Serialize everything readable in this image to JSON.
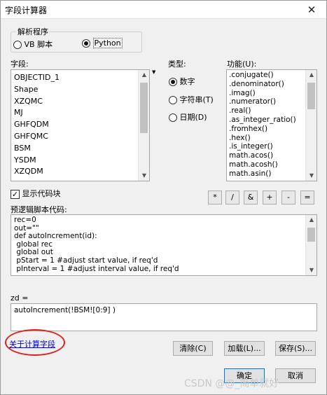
{
  "window": {
    "title": "字段计算器",
    "close_glyph": "✕"
  },
  "parser": {
    "label": "解析程序",
    "options": [
      {
        "label": "VB 脚本",
        "selected": false
      },
      {
        "label": "Python",
        "selected": true
      }
    ]
  },
  "fields": {
    "label": "字段:",
    "items": [
      "OBJECTID_1",
      "Shape",
      "XZQMC",
      "MJ",
      "GHFQDM",
      "GHFQMC",
      "BSM",
      "YSDM",
      "XZQDM"
    ]
  },
  "type": {
    "label": "类型:",
    "options": [
      {
        "label": "数字",
        "selected": true
      },
      {
        "label": "字符串(T)",
        "selected": false
      },
      {
        "label": "日期(D)",
        "selected": false
      }
    ]
  },
  "functions": {
    "label": "功能(U):",
    "items": [
      ".conjugate()",
      ".denominator()",
      ".imag()",
      ".numerator()",
      ".real()",
      ".as_integer_ratio()",
      ".fromhex()",
      ".hex()",
      ".is_integer()",
      "math.acos()",
      "math.acosh()",
      "math.asin()"
    ]
  },
  "show_codeblock": {
    "label": "显示代码块",
    "checked": true
  },
  "operators": [
    "*",
    "/",
    "&",
    "+",
    "-",
    "="
  ],
  "prelogic": {
    "label": "预逻辑脚本代码:",
    "lines": [
      "rec=0",
      "out=\"\"",
      "def autoIncrement(id):",
      " global rec",
      " global out",
      " pStart = 1 #adjust start value, if req'd",
      " pInterval = 1 #adjust interval value, if req'd"
    ]
  },
  "expression": {
    "label": "zd =",
    "value": "autoIncrement(!BSM![0:9] )"
  },
  "about_link": "关于计算字段",
  "buttons": {
    "clear": "清除(C)",
    "load": "加载(L)...",
    "save": "保存(S)...",
    "ok": "确定",
    "cancel": "取消"
  },
  "watermark": "CSDN @@_简单就好"
}
